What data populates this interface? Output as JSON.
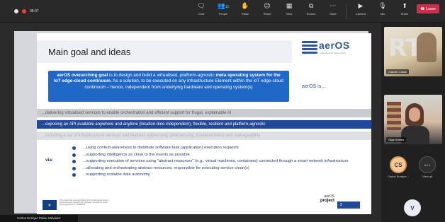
{
  "meeting": {
    "timer": "08:07"
  },
  "toolbar": {
    "items": [
      {
        "label": "Chat",
        "icon": "chat-icon"
      },
      {
        "label": "People",
        "icon": "people-icon",
        "badge": "21"
      },
      {
        "label": "Raise",
        "icon": "raise-hand-icon"
      },
      {
        "label": "React",
        "icon": "react-icon"
      },
      {
        "label": "View",
        "icon": "view-icon"
      },
      {
        "label": "Rooms",
        "icon": "rooms-icon"
      },
      {
        "label": "More",
        "icon": "more-icon"
      },
      {
        "label": "Camera",
        "icon": "camera-icon"
      },
      {
        "label": "Mic",
        "icon": "mic-icon"
      },
      {
        "label": "Share",
        "icon": "share-icon"
      }
    ],
    "leave_label": "Leave",
    "leave_color": "#c4314b"
  },
  "slide": {
    "title": "Main goal and ideas",
    "logo_text": "aerOS",
    "logo_sub": "Federated IoT Edge-Cloud",
    "goal_lead": "aerOS overarching goal",
    "goal_text": " is to design and build a virtualised, platform-agnostic ",
    "goal_bold": "meta operating system for the IoT edge-cloud continuum.",
    "goal_tail": " As a solution, to be executed on any Infrastructure Element within the IoT edge-cloud continuum – hence, independent from underlying hardware and operating system(s)",
    "aeros_is": "aerOS is…",
    "bands": [
      "…delivering virtualised services to enable orchestration and efficient support for frugal, explainable AI",
      "…exposing an API available anywhere and anytime (location-time independent), flexible, resilient and platform-agnostic",
      "…including a set of infrastructural services and features addressing cybersecurity, trustworthiness and manageability"
    ],
    "via_label": "via:",
    "bullets": [
      "…using context-awareness to distribute software task (application) execution requests",
      "…supporting intelligence as close to the events as possible",
      "…supporting execution of services using \"abstract resources\" (e.g., virtual machines, containers) connected through a smart network infrastructure",
      "…allocating and orchestrating abstract resources, responsible for executing service chain(s)",
      "…supporting scalable data autonomy"
    ],
    "eu_text": "This project has received funding from the European Union's Horizon Europe research and innovation programme under grant agreement N° 101069732",
    "footer_project_line1": "aerOS",
    "footer_project_line2": "project",
    "page_no": "2",
    "colors": {
      "goal_box": "#1f68c7",
      "band_dark": "#1f4a9a",
      "logo": "#2f57a0"
    }
  },
  "presenter_name": "Carlos Enrique Palau Salvador",
  "side": {
    "tile1_name": "Claudio Calaio",
    "tile2_name": "Olga Suarez",
    "participants": [
      {
        "initials": "CS",
        "name": "Carlos Enrique..."
      },
      {
        "initials": "⋯",
        "name": "View all"
      }
    ],
    "extra_initial": "V"
  }
}
